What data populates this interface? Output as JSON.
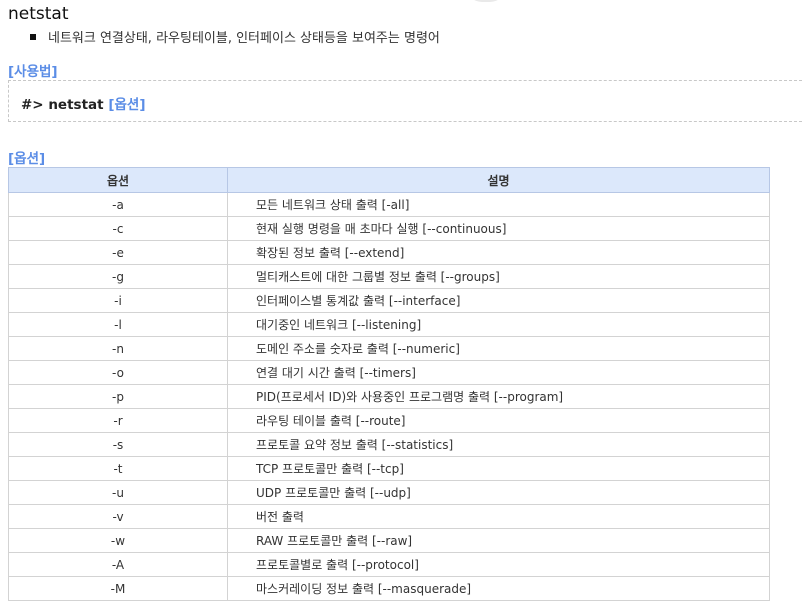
{
  "title": "netstat",
  "description": "네트워크 연결상태, 라우팅테이블, 인터페이스 상태등을 보여주는 명령어",
  "usage": {
    "label": "[사용법]",
    "command": "#> netstat",
    "option_placeholder": "[옵션]"
  },
  "options_section": {
    "label": "[옵션]",
    "headers": [
      "옵션",
      "설명"
    ],
    "rows": [
      {
        "option": "-a",
        "desc": "모든 네트워크 상태 출력 [-all]"
      },
      {
        "option": "-c",
        "desc": "현재 실행 명령을 매 초마다 실행 [--continuous]"
      },
      {
        "option": "-e",
        "desc": "확장된 정보 출력 [--extend]"
      },
      {
        "option": "-g",
        "desc": "멀티캐스트에 대한 그룹별 정보 출력 [--groups]"
      },
      {
        "option": "-i",
        "desc": "인터페이스별 통계값 출력 [--interface]"
      },
      {
        "option": "-l",
        "desc": "대기중인 네트워크 [--listening]"
      },
      {
        "option": "-n",
        "desc": "도메인 주소를 숫자로 출력 [--numeric]"
      },
      {
        "option": "-o",
        "desc": "연결 대기 시간 출력 [--timers]"
      },
      {
        "option": "-p",
        "desc": "PID(프로세서 ID)와 사용중인 프로그램명 출력 [--program]"
      },
      {
        "option": "-r",
        "desc": "라우팅 테이블 출력 [--route]"
      },
      {
        "option": "-s",
        "desc": "프로토콜 요약 정보 출력 [--statistics]"
      },
      {
        "option": "-t",
        "desc": "TCP 프로토콜만 출력 [--tcp]"
      },
      {
        "option": "-u",
        "desc": "UDP 프로토콜만 출력 [--udp]"
      },
      {
        "option": "-v",
        "desc": "버전 출력"
      },
      {
        "option": "-w",
        "desc": "RAW 프로토콜만 출력 [--raw]"
      },
      {
        "option": "-A",
        "desc": "프로토콜별로 출력 [--protocol]"
      },
      {
        "option": "-M",
        "desc": "마스커레이딩 정보 출력 [--masquerade]"
      }
    ]
  },
  "colors": {
    "accent": "#5b8de6",
    "header_bg": "#dce8fb"
  },
  "icons": {
    "bullet": "square-bullet-icon"
  }
}
